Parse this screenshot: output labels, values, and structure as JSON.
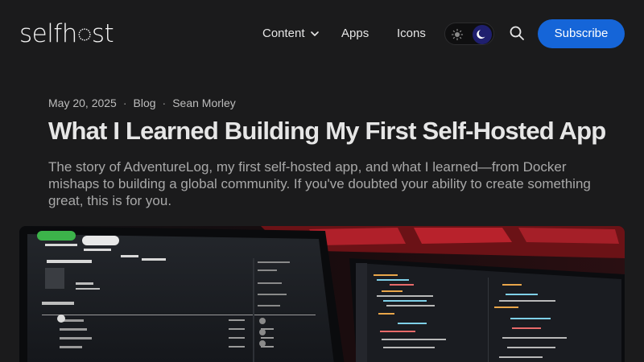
{
  "site": {
    "logo": "selfh◌st"
  },
  "nav": {
    "items": [
      {
        "label": "Content"
      },
      {
        "label": "Apps"
      },
      {
        "label": "Icons"
      }
    ],
    "subscribe_label": "Subscribe"
  },
  "article": {
    "date": "May 20, 2025",
    "tag": "Blog",
    "author": "Sean Morley",
    "separator": "·",
    "title": "What I Learned Building My First Self-Hosted App",
    "excerpt": "The story of AdventureLog, my first self-hosted app, and what I learned—from Docker mishaps to building a global community. If you've doubted your ability to create something great, this is for you."
  },
  "colors": {
    "background": "#1b1b1c",
    "accent": "#1565d8",
    "moon_knob": "#1f1f6e"
  },
  "icons": {
    "content_dropdown": "chevron-down-icon",
    "light_mode": "sun-icon",
    "dark_mode": "moon-icon",
    "search": "search-icon"
  }
}
